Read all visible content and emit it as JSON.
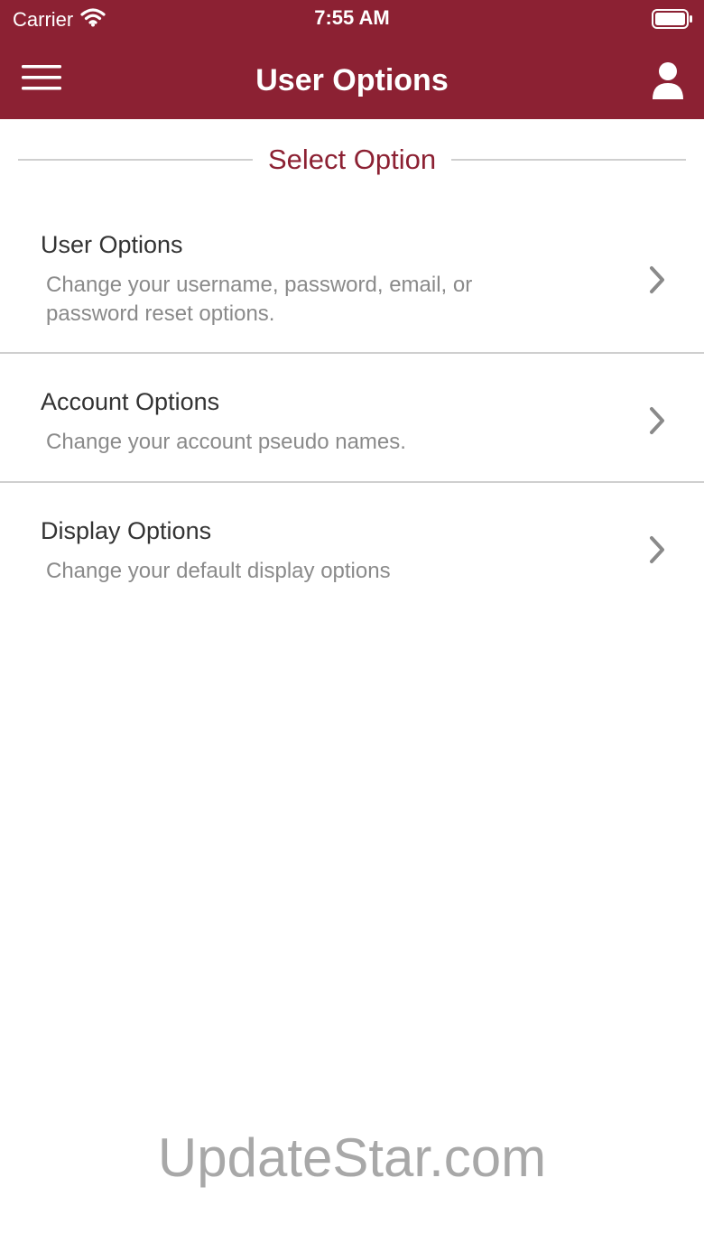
{
  "status_bar": {
    "carrier": "Carrier",
    "time": "7:55 AM"
  },
  "nav": {
    "title": "User Options"
  },
  "section": {
    "title": "Select Option"
  },
  "options": [
    {
      "title": "User Options",
      "description": "Change your username, password, email, or password reset options."
    },
    {
      "title": "Account Options",
      "description": "Change your account pseudo names."
    },
    {
      "title": "Display Options",
      "description": "Change your default display options"
    }
  ],
  "watermark": "UpdateStar.com",
  "icons": {
    "menu": "hamburger-menu-icon",
    "user": "user-profile-icon",
    "chevron": "chevron-right-icon",
    "wifi": "wifi-icon",
    "battery": "battery-icon"
  },
  "colors": {
    "brand": "#8c2133",
    "divider": "#cfcfcf",
    "title_text": "#333333",
    "secondary_text": "#8a8a8a"
  }
}
